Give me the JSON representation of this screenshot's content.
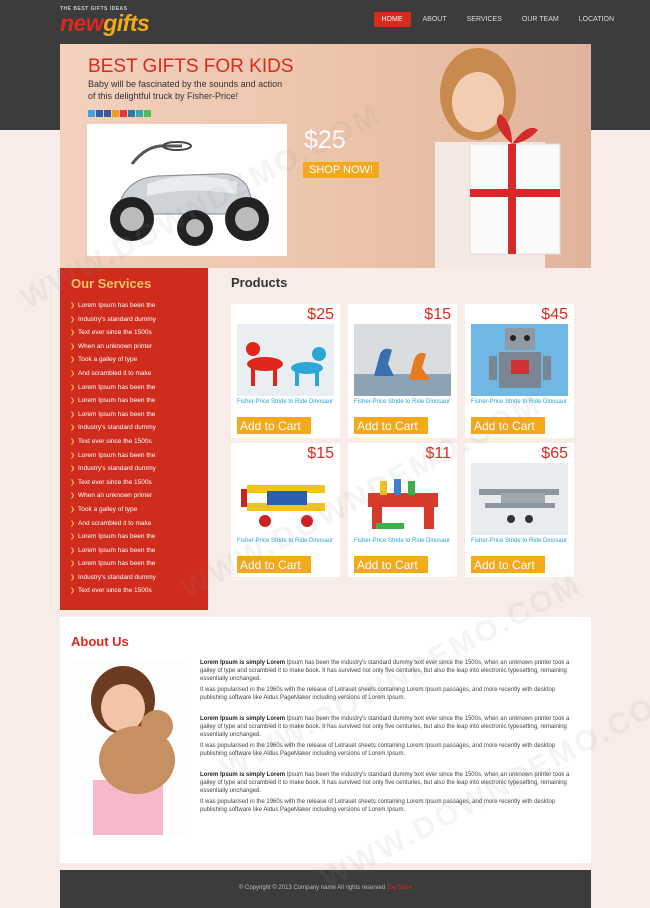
{
  "logo": {
    "tagline": "THE BEST GIFTS IDEAS",
    "part1": "new",
    "part2": "gifts"
  },
  "nav": [
    {
      "label": "HOME",
      "active": true
    },
    {
      "label": "ABOUT"
    },
    {
      "label": "SERVICES"
    },
    {
      "label": "OUR TEAM"
    },
    {
      "label": "LOCATION"
    }
  ],
  "hero": {
    "title": "BEST GIFTS FOR KIDS",
    "subtitle": "Baby will be fascinated by the sounds and action of this delightful truck by Fisher-Price!",
    "price": "$25",
    "cta": "SHOP NOW!"
  },
  "services": {
    "title": "Our Services",
    "items": [
      "Lorem Ipsum has been the",
      "Industry's standard dummy",
      "Text ever since the 1500s",
      "When an unknown printer",
      "Took a galley of type",
      "And scrambled it to make",
      "Lorem Ipsum has been the",
      "Lorem Ipsum has been the",
      "Lorem Ipsum has been the",
      "Industry's standard dummy",
      "Text ever since the 1500s",
      "Lorem Ipsum has been the",
      "Industry's standard dummy",
      "Text ever since the 1500s",
      "When an unknown printer",
      "Took a galley of type",
      "And scrambled it to make",
      "Lorem Ipsum has been the",
      "Lorem Ipsum has been the",
      "Lorem Ipsum has been the",
      "Industry's standard dummy",
      "Text ever since the 1500s"
    ]
  },
  "products": {
    "title": "Products",
    "items": [
      {
        "price": "$25",
        "desc": "Fisher-Price Stride to Ride Dinosaur",
        "cta": "Add to Cart",
        "image": "balloon-dogs"
      },
      {
        "price": "$15",
        "desc": "Fisher-Price Stride to Ride Dinosaur",
        "cta": "Add to Cart",
        "image": "toy-dinosaurs"
      },
      {
        "price": "$45",
        "desc": "Fisher-Price Stride to Ride Dinosaur",
        "cta": "Add to Cart",
        "image": "toy-robot"
      },
      {
        "price": "$15",
        "desc": "Fisher-Price Stride to Ride Dinosaur",
        "cta": "Add to Cart",
        "image": "toy-plane"
      },
      {
        "price": "$11",
        "desc": "Fisher-Price Stride to Ride Dinosaur",
        "cta": "Add to Cart",
        "image": "peg-bench"
      },
      {
        "price": "$65",
        "desc": "Fisher-Price Stride to Ride Dinosaur",
        "cta": "Add to Cart",
        "image": "biplane-model"
      }
    ]
  },
  "about": {
    "title": "About Us",
    "p_bold": "Lorem Ipsum is simply Lorem",
    "p1_rest": "Ipsum has been the industry's standard dummy text ever since the 1500s, when an unknown printer took a galley of type and scrambled it to make book. It has survived not only five centuries, but also the leap into electronic typesetting, remaining essentially unchanged.",
    "p2": "It was popularised in the 1960s with the release of Letraset sheets containing Lorem Ipsum passages, and more recently with desktop publishing software like Aldus PageMaker including versions of Lorem Ipsum."
  },
  "footer": {
    "text": "© Copyright © 2013 Company name All rights reserved",
    "link": "Toy Store"
  },
  "watermark": "WWW.DOWNDEMO.COM",
  "colors": {
    "accent": "#d92a1e",
    "button": "#f2a91a",
    "dark": "#3c3c3c"
  }
}
